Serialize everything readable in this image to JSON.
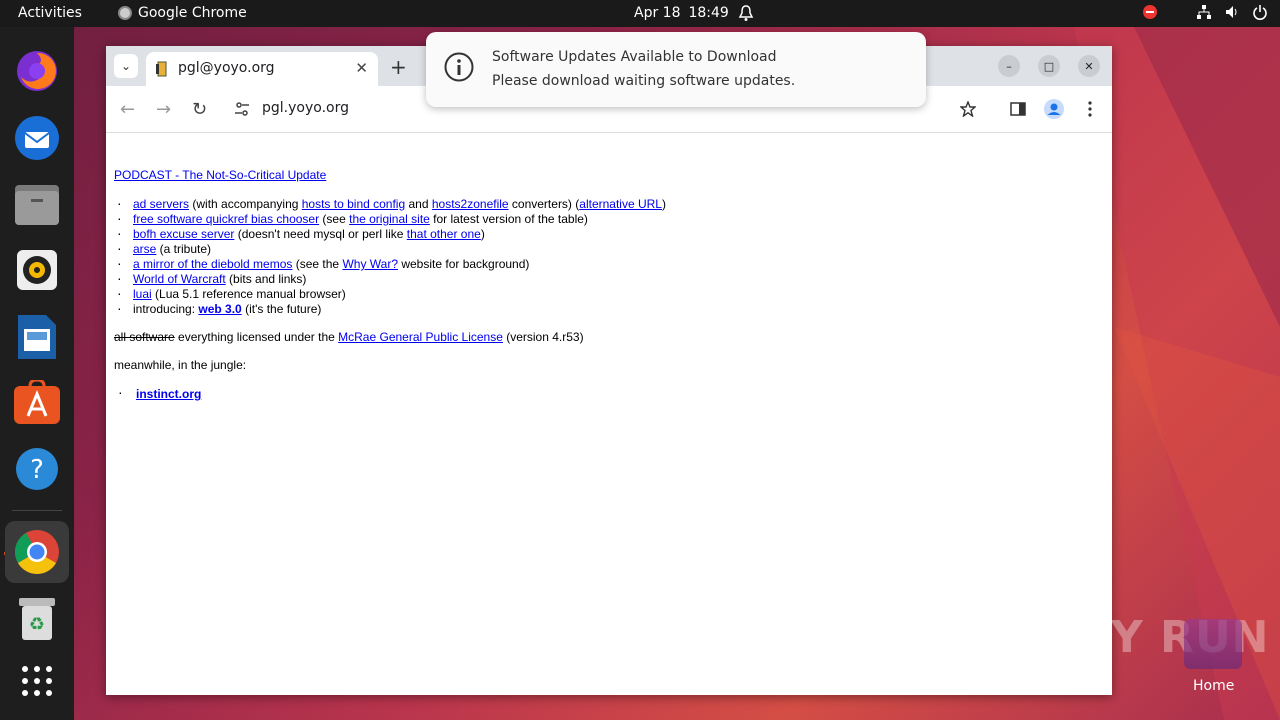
{
  "topbar": {
    "activities": "Activities",
    "app_name": "Google Chrome",
    "date": "Apr 18",
    "time": "18:49"
  },
  "dock": {
    "items": [
      "firefox-icon",
      "thunderbird-icon",
      "files-icon",
      "rhythmbox-icon",
      "writer-icon",
      "app-center-icon",
      "help-icon",
      "chrome-icon",
      "trash-icon",
      "app-grid-icon"
    ]
  },
  "browser": {
    "tab_title": "pgl@yoyo.org",
    "url": "pgl.yoyo.org"
  },
  "notification": {
    "title": "Software Updates Available to Download",
    "body": "Please download waiting software updates."
  },
  "page": {
    "podcast_link": "PODCAST - The Not-So-Critical Update",
    "items": [
      {
        "link1": "ad servers",
        "t1": " (with accompanying ",
        "link2": "hosts to bind config",
        "t2": " and ",
        "link3": "hosts2zonefile",
        "t3": " converters) (",
        "link4": "alternative URL",
        "t4": ")"
      },
      {
        "link1": "free software quickref bias chooser",
        "t1": " (see ",
        "link2": "the original site",
        "t2": " for latest version of the table)"
      },
      {
        "link1": "bofh excuse server",
        "t1": " (doesn't need mysql or perl like ",
        "link2": "that other one",
        "t2": ")"
      },
      {
        "link1": "arse",
        "t1": " (a tribute)"
      },
      {
        "link1": "a mirror of the diebold memos",
        "t1": " (see the ",
        "link2": "Why War?",
        "t2": " website for background)"
      },
      {
        "link1": "World of Warcraft",
        "t1": " (bits and links)"
      },
      {
        "link1": "luai",
        "t1": " (Lua 5.1 reference manual browser)"
      },
      {
        "pre": "introducing: ",
        "link1": "web 3.0",
        "t1": " (it's the future)"
      }
    ],
    "license_strike": "all software",
    "license_text": " everything licensed under the ",
    "license_link": "McRae General Public License",
    "license_tail": " (version 4.r53)",
    "jungle": "meanwhile, in the jungle:",
    "instinct": "instinct.org"
  },
  "desktop": {
    "watermark": "ANY RUN",
    "home_label": "Home"
  }
}
